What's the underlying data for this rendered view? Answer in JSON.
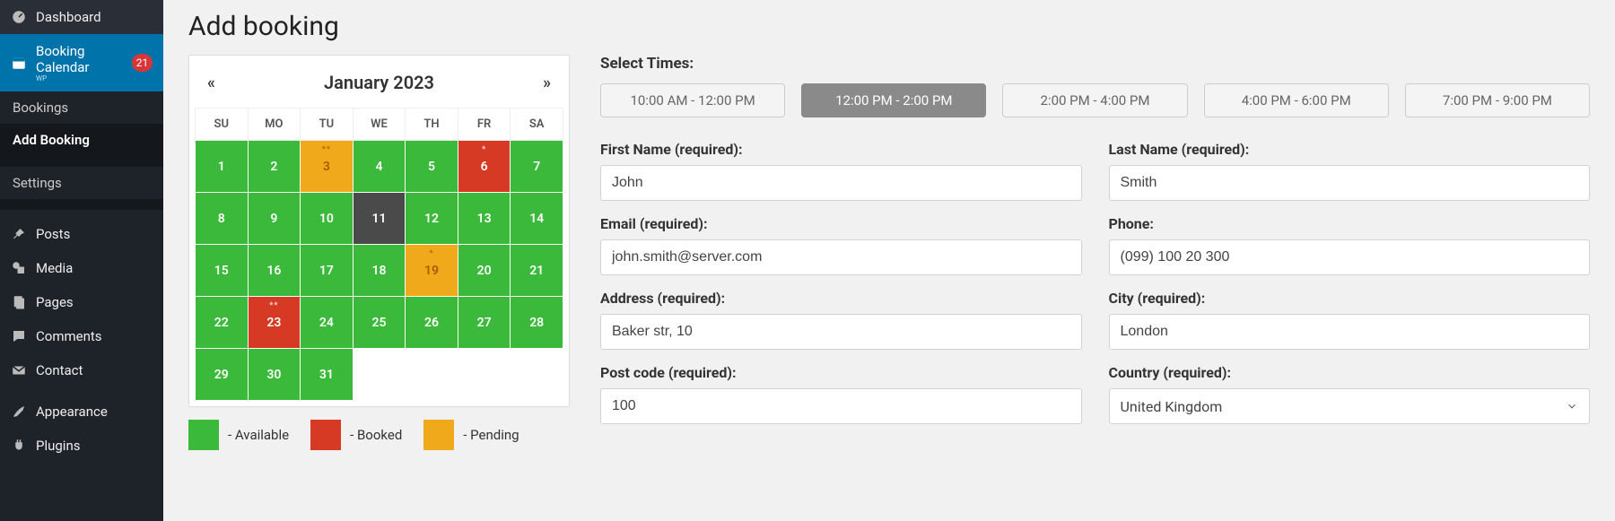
{
  "sidebar": {
    "items": [
      {
        "icon": "dashboard",
        "label": "Dashboard",
        "state": "normal"
      },
      {
        "icon": "calendar",
        "label": "Booking Calendar",
        "sub": "WP",
        "state": "active",
        "badge": "21"
      }
    ],
    "subnav": [
      {
        "label": "Bookings",
        "state": "normal"
      },
      {
        "label": "Add Booking",
        "state": "current"
      }
    ],
    "settings": {
      "label": "Settings"
    },
    "items2": [
      {
        "icon": "pin",
        "label": "Posts"
      },
      {
        "icon": "media",
        "label": "Media"
      },
      {
        "icon": "page",
        "label": "Pages"
      },
      {
        "icon": "comment",
        "label": "Comments"
      },
      {
        "icon": "mail",
        "label": "Contact"
      }
    ],
    "items3": [
      {
        "icon": "brush",
        "label": "Appearance"
      },
      {
        "icon": "plug",
        "label": "Plugins"
      }
    ]
  },
  "page": {
    "title": "Add booking"
  },
  "calendar": {
    "title": "January 2023",
    "weekdays": [
      "SU",
      "MO",
      "TU",
      "WE",
      "TH",
      "FR",
      "SA"
    ],
    "weeks": [
      [
        {
          "day": "1",
          "status": "available"
        },
        {
          "day": "2",
          "status": "available"
        },
        {
          "day": "3",
          "status": "pending",
          "dots": "**"
        },
        {
          "day": "4",
          "status": "available"
        },
        {
          "day": "5",
          "status": "available"
        },
        {
          "day": "6",
          "status": "booked",
          "dots": "*"
        },
        {
          "day": "7",
          "status": "available"
        }
      ],
      [
        {
          "day": "8",
          "status": "available"
        },
        {
          "day": "9",
          "status": "available"
        },
        {
          "day": "10",
          "status": "available"
        },
        {
          "day": "11",
          "status": "greyed"
        },
        {
          "day": "12",
          "status": "available"
        },
        {
          "day": "13",
          "status": "available"
        },
        {
          "day": "14",
          "status": "available"
        }
      ],
      [
        {
          "day": "15",
          "status": "available"
        },
        {
          "day": "16",
          "status": "available"
        },
        {
          "day": "17",
          "status": "available"
        },
        {
          "day": "18",
          "status": "available"
        },
        {
          "day": "19",
          "status": "pending",
          "dots": "*"
        },
        {
          "day": "20",
          "status": "available"
        },
        {
          "day": "21",
          "status": "available"
        }
      ],
      [
        {
          "day": "22",
          "status": "available"
        },
        {
          "day": "23",
          "status": "booked",
          "dots": "**"
        },
        {
          "day": "24",
          "status": "available"
        },
        {
          "day": "25",
          "status": "available"
        },
        {
          "day": "26",
          "status": "available"
        },
        {
          "day": "27",
          "status": "available"
        },
        {
          "day": "28",
          "status": "available"
        }
      ],
      [
        {
          "day": "29",
          "status": "available"
        },
        {
          "day": "30",
          "status": "available"
        },
        {
          "day": "31",
          "status": "available"
        },
        {
          "day": "",
          "status": "empty"
        },
        {
          "day": "",
          "status": "empty"
        },
        {
          "day": "",
          "status": "empty"
        },
        {
          "day": "",
          "status": "empty"
        }
      ]
    ],
    "legend": {
      "available": "- Available",
      "booked": "- Booked",
      "pending": "- Pending"
    }
  },
  "form": {
    "select_times_label": "Select Times:",
    "slots": [
      {
        "label": "10:00 AM - 12:00 PM",
        "active": false
      },
      {
        "label": "12:00 PM - 2:00 PM",
        "active": true
      },
      {
        "label": "2:00 PM - 4:00 PM",
        "active": false
      },
      {
        "label": "4:00 PM - 6:00 PM",
        "active": false
      },
      {
        "label": "7:00 PM - 9:00 PM",
        "active": false
      }
    ],
    "first_name": {
      "label": "First Name (required):",
      "value": "John"
    },
    "last_name": {
      "label": "Last Name (required):",
      "value": "Smith"
    },
    "email": {
      "label": "Email (required):",
      "value": "john.smith@server.com"
    },
    "phone": {
      "label": "Phone:",
      "value": "(099) 100 20 300"
    },
    "address": {
      "label": "Address (required):",
      "value": "Baker str, 10"
    },
    "city": {
      "label": "City (required):",
      "value": "London"
    },
    "postcode": {
      "label": "Post code (required):",
      "value": "100"
    },
    "country": {
      "label": "Country (required):",
      "value": "United Kingdom"
    }
  }
}
